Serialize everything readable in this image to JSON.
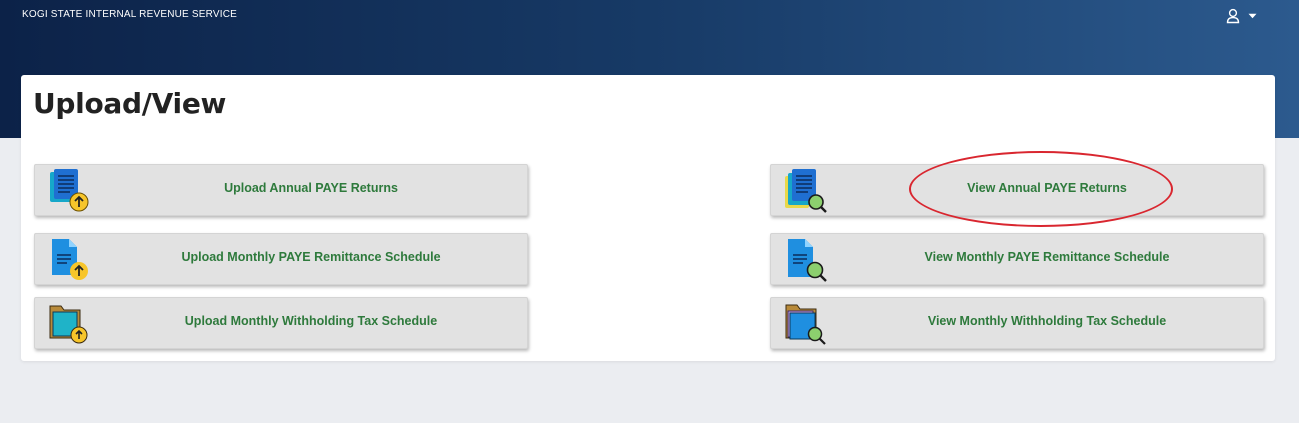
{
  "header": {
    "brand": "KOGI STATE INTERNAL REVENUE SERVICE"
  },
  "user_menu": {
    "icon": "user-icon",
    "caret": "caret-down-icon"
  },
  "page": {
    "title": "Upload/View"
  },
  "tiles": [
    {
      "label": "Upload Annual PAYE Returns",
      "icon": "document-upload-icon"
    },
    {
      "label": "View Annual PAYE Returns",
      "icon": "document-search-icon"
    },
    {
      "label": "Upload Monthly PAYE Remittance Schedule",
      "icon": "file-upload-icon"
    },
    {
      "label": "View Monthly PAYE Remittance Schedule",
      "icon": "file-search-icon"
    },
    {
      "label": "Upload Monthly Withholding Tax Schedule",
      "icon": "folder-upload-icon"
    },
    {
      "label": "View Monthly Withholding Tax Schedule",
      "icon": "folder-search-icon"
    }
  ],
  "colors": {
    "header_start": "#0c2248",
    "header_end": "#2c5a8e",
    "tile_label": "#2e7a3c",
    "highlight": "#d9262f"
  }
}
